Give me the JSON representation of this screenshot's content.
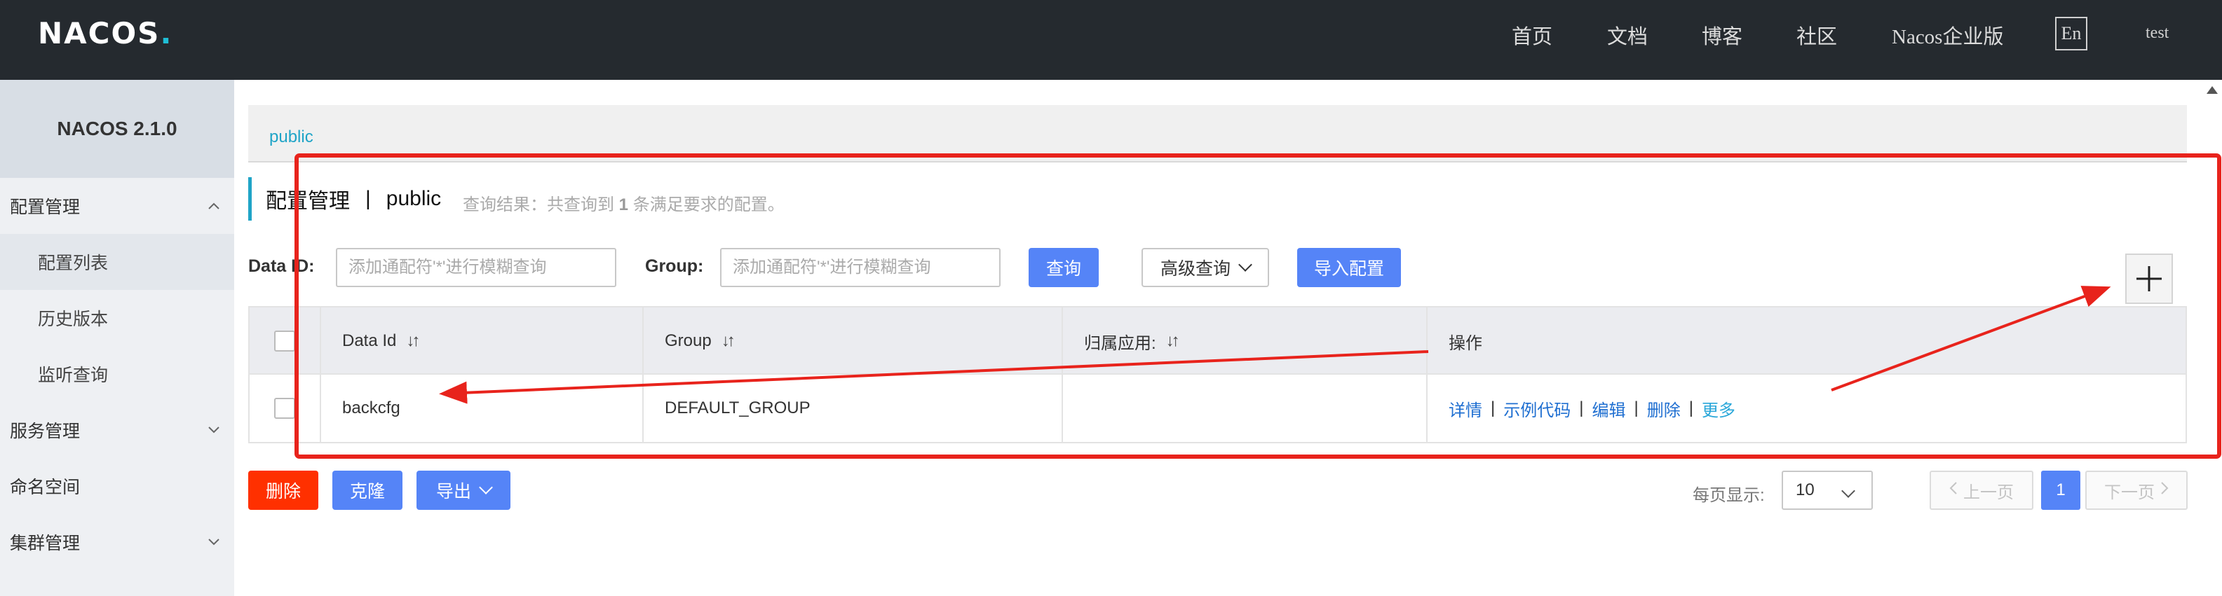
{
  "header": {
    "logo": "NACOS",
    "logo_dot": ".",
    "nav": [
      "首页",
      "文档",
      "博客",
      "社区",
      "Nacos企业版"
    ],
    "lang": "En",
    "user": "test"
  },
  "sidebar": {
    "version": "NACOS 2.1.0",
    "items": [
      {
        "label": "配置管理",
        "type": "group",
        "expanded": true
      },
      {
        "label": "配置列表",
        "type": "sub",
        "active": true
      },
      {
        "label": "历史版本",
        "type": "sub"
      },
      {
        "label": "监听查询",
        "type": "sub"
      },
      {
        "label": "服务管理",
        "type": "group",
        "expanded": false
      },
      {
        "label": "命名空间",
        "type": "item"
      },
      {
        "label": "集群管理",
        "type": "group",
        "expanded": false
      }
    ]
  },
  "namespace_tab": "public",
  "title": {
    "main": "配置管理",
    "separator": "|",
    "namespace": "public",
    "result_prefix": "查询结果：共查询到 ",
    "result_count": "1",
    "result_suffix": " 条满足要求的配置。"
  },
  "filters": {
    "dataid_label": "Data ID:",
    "dataid_placeholder": "添加通配符'*'进行模糊查询",
    "group_label": "Group:",
    "group_placeholder": "添加通配符'*'进行模糊查询",
    "query_btn": "查询",
    "advanced_btn": "高级查询",
    "import_btn": "导入配置",
    "add_symbol": "+"
  },
  "table": {
    "columns": [
      "Data Id",
      "Group",
      "归属应用:",
      "操作"
    ],
    "rows": [
      {
        "data_id": "backcfg",
        "group": "DEFAULT_GROUP",
        "app": ""
      }
    ],
    "actions": [
      "详情",
      "示例代码",
      "编辑",
      "删除",
      "更多"
    ]
  },
  "bulk": {
    "delete": "删除",
    "clone": "克隆",
    "export": "导出"
  },
  "pagination": {
    "per_page_label": "每页显示:",
    "per_page": "10",
    "prev": "上一页",
    "current": "1",
    "next": "下一页"
  },
  "colors": {
    "header_bg": "#252a2f",
    "primary": "#5584f7",
    "danger": "#ff3000",
    "link": "#1f6fd1",
    "accent": "#1fa4c7",
    "annotation": "#e8231c"
  }
}
